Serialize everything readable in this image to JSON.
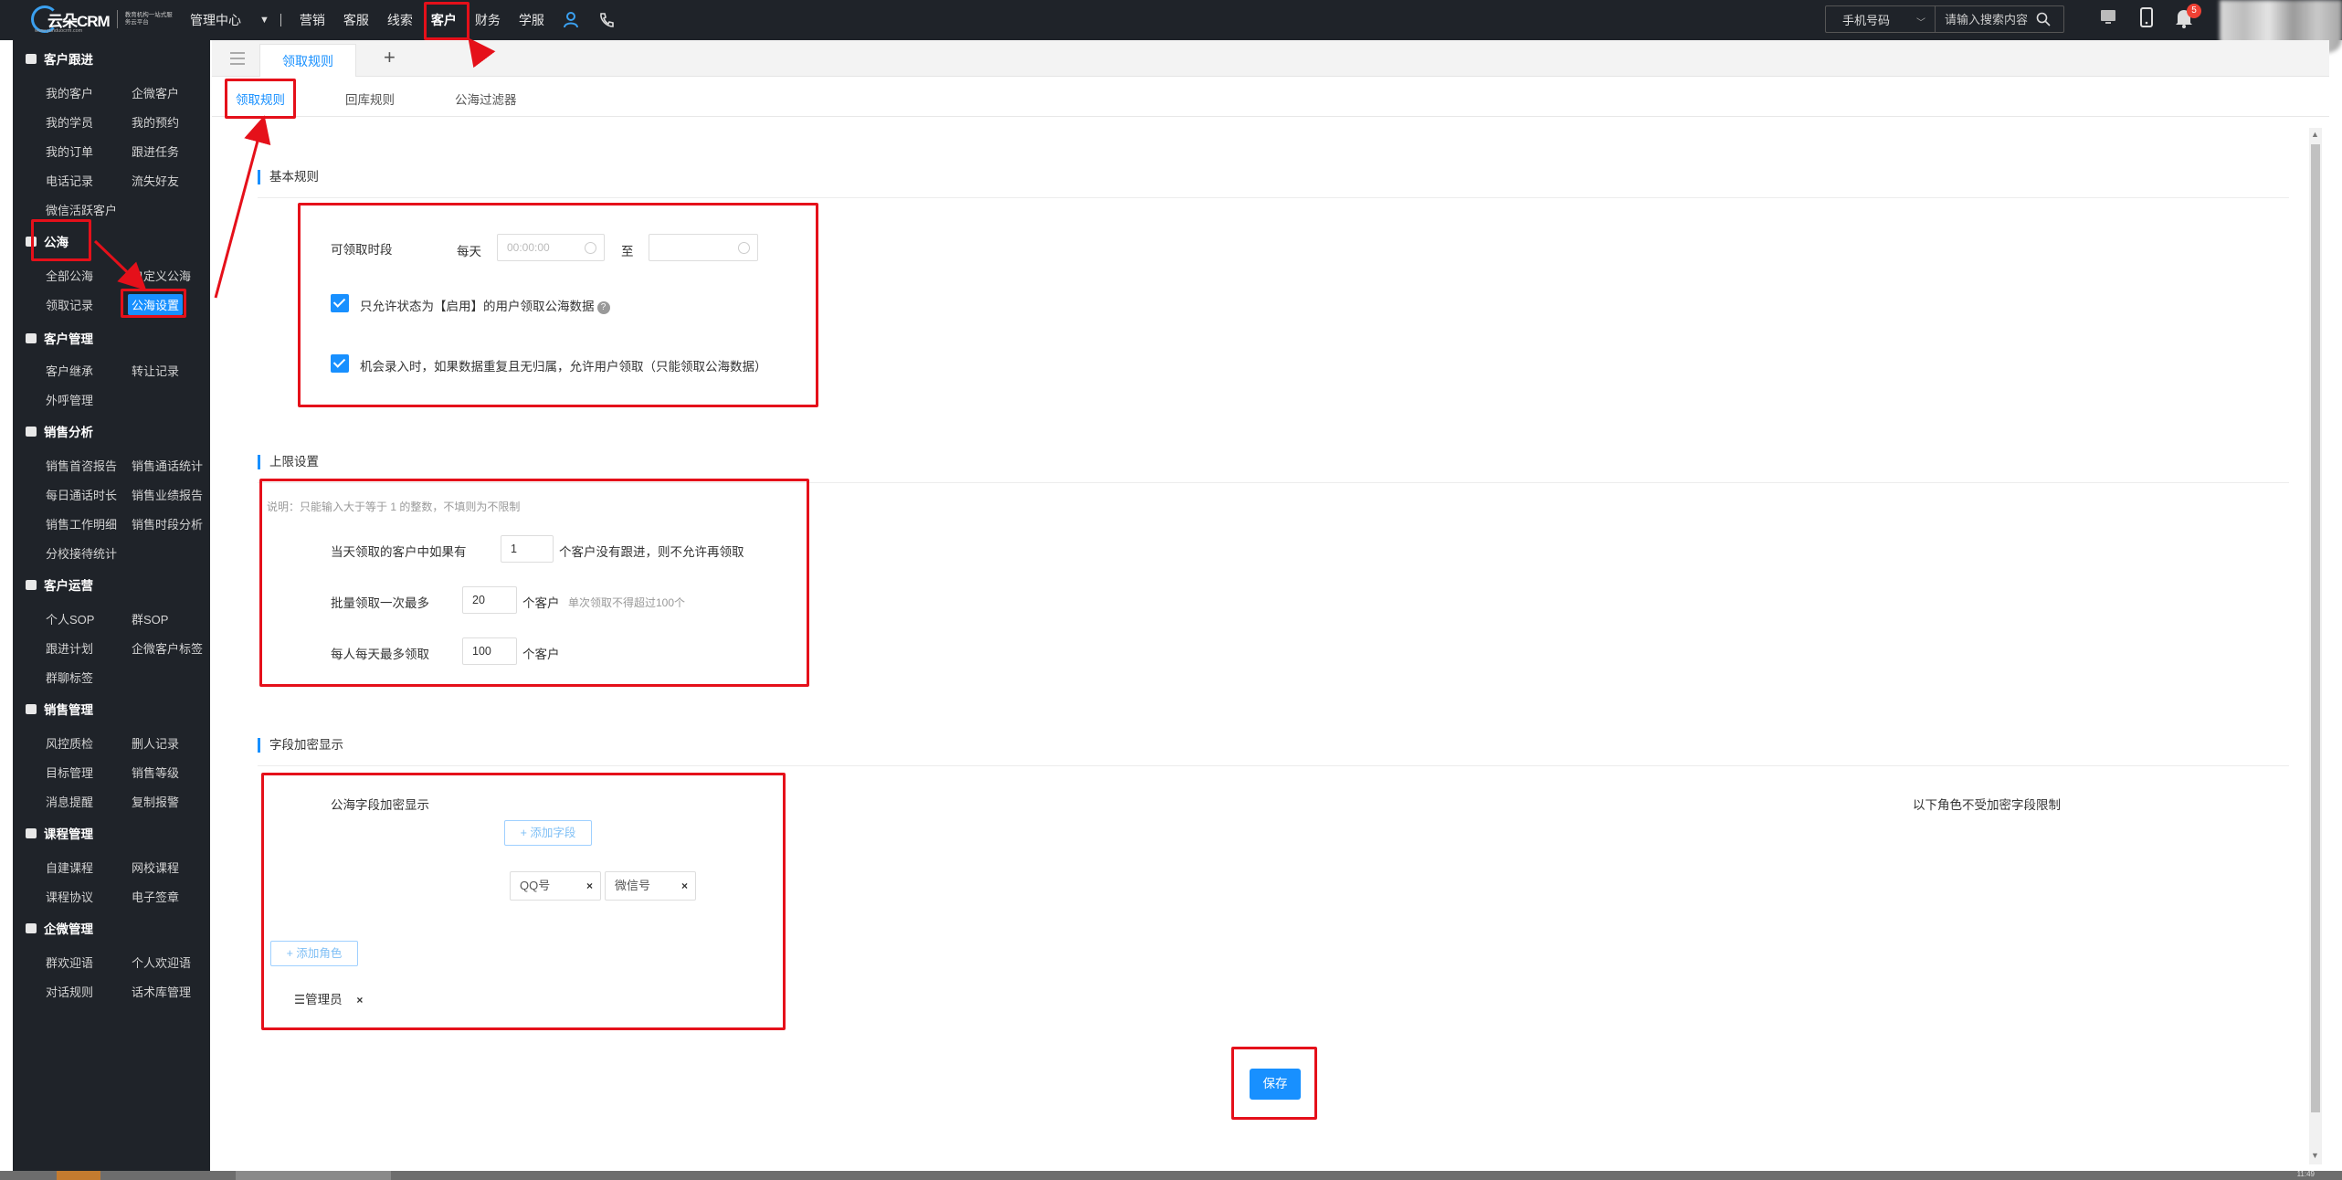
{
  "brand": {
    "name": "云朵CRM",
    "slogan": "教育机构一站式服务云平台",
    "url": "www.yunduocrm.com"
  },
  "topnav": {
    "admin_center": "管理中心",
    "items": [
      "营销",
      "客服",
      "线索",
      "客户",
      "财务",
      "学服"
    ],
    "active": "客户"
  },
  "search": {
    "type_label": "手机号码",
    "placeholder": "请输入搜索内容"
  },
  "notifications": {
    "count": "5"
  },
  "sidebar": {
    "groups": [
      {
        "title": "客户跟进",
        "items": [
          "我的客户",
          "企微客户",
          "我的学员",
          "我的预约",
          "我的订单",
          "跟进任务",
          "电话记录",
          "流失好友",
          "微信活跃客户"
        ]
      },
      {
        "title": "公海",
        "items": [
          "全部公海",
          "自定义公海",
          "领取记录",
          "公海设置"
        ]
      },
      {
        "title": "客户管理",
        "items": [
          "客户继承",
          "转让记录",
          "外呼管理"
        ]
      },
      {
        "title": "销售分析",
        "items": [
          "销售首咨报告",
          "销售通话统计",
          "每日通话时长",
          "销售业绩报告",
          "销售工作明细",
          "销售时段分析",
          "分校接待统计"
        ]
      },
      {
        "title": "客户运营",
        "items": [
          "个人SOP",
          "群SOP",
          "跟进计划",
          "企微客户标签",
          "群聊标签"
        ]
      },
      {
        "title": "销售管理",
        "items": [
          "风控质检",
          "删人记录",
          "目标管理",
          "销售等级",
          "消息提醒",
          "复制报警"
        ]
      },
      {
        "title": "课程管理",
        "items": [
          "自建课程",
          "网校课程",
          "课程协议",
          "电子签章"
        ]
      },
      {
        "title": "企微管理",
        "items": [
          "群欢迎语",
          "个人欢迎语",
          "对话规则",
          "话术库管理"
        ]
      }
    ],
    "active_item": "公海设置"
  },
  "tabs": {
    "open_tab": "领取规则",
    "add": "+"
  },
  "subtabs": [
    "领取规则",
    "回库规则",
    "公海过滤器"
  ],
  "basic_rules": {
    "title": "基本规则",
    "claim_period_label": "可领取时段",
    "daily_label": "每天",
    "start_placeholder": "00:00:00",
    "to_label": "至",
    "check1": "只允许状态为【启用】的用户领取公海数据",
    "check2": "机会录入时，如果数据重复且无归属，允许用户领取（只能领取公海数据）",
    "help": "?"
  },
  "limit_settings": {
    "title": "上限设置",
    "note": "说明：只能输入大于等于 1 的整数，不填则为不限制",
    "row1_prefix": "当天领取的客户中如果有",
    "row1_value": "1",
    "row1_suffix": "个客户没有跟进，则不允许再领取",
    "row2_prefix": "批量领取一次最多",
    "row2_value": "20",
    "row2_suffix": "个客户",
    "row2_hint": "单次领取不得超过100个",
    "row3_prefix": "每人每天最多领取",
    "row3_value": "100",
    "row3_suffix": "个客户"
  },
  "field_encrypt": {
    "title": "字段加密显示",
    "label": "公海字段加密显示",
    "add_field": "+ 添加字段",
    "fields": [
      "QQ号",
      "微信号"
    ],
    "add_role": "+ 添加角色",
    "role": "管理员",
    "exempt_label": "以下角色不受加密字段限制",
    "remove": "×"
  },
  "save_label": "保存",
  "taskbar_time": "11:49",
  "colors": {
    "accent": "#1890ff",
    "annotation": "#e5101a",
    "topbar": "#1f2329"
  }
}
